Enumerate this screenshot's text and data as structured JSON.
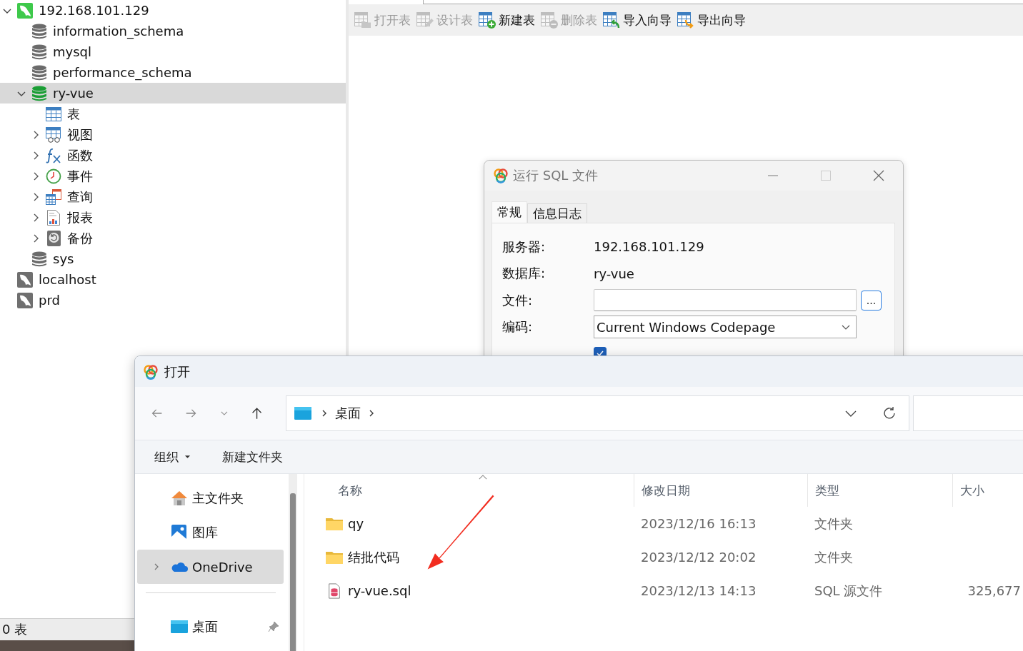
{
  "main": {
    "tree": [
      {
        "kind": "connection",
        "label": "192.168.101.129",
        "connected": true,
        "selected": false,
        "expanded": true,
        "children": [
          {
            "kind": "database",
            "label": "information_schema",
            "open": false,
            "selected": false
          },
          {
            "kind": "database",
            "label": "mysql",
            "open": false,
            "selected": false
          },
          {
            "kind": "database",
            "label": "performance_schema",
            "open": false,
            "selected": false
          },
          {
            "kind": "database",
            "label": "ry-vue",
            "open": true,
            "selected": true,
            "expanded": true,
            "children": [
              {
                "kind": "tables",
                "label": "表",
                "selected": false
              },
              {
                "kind": "views",
                "label": "视图",
                "selected": false,
                "expanded": false
              },
              {
                "kind": "functions",
                "label": "函数",
                "selected": false,
                "expanded": false
              },
              {
                "kind": "events",
                "label": "事件",
                "selected": false,
                "expanded": false
              },
              {
                "kind": "queries",
                "label": "查询",
                "selected": false,
                "expanded": false
              },
              {
                "kind": "reports",
                "label": "报表",
                "selected": false,
                "expanded": false
              },
              {
                "kind": "backups",
                "label": "备份",
                "selected": false,
                "expanded": false
              }
            ]
          },
          {
            "kind": "database",
            "label": "sys",
            "open": false,
            "selected": false
          }
        ]
      },
      {
        "kind": "connection",
        "label": "localhost",
        "connected": false,
        "selected": false
      },
      {
        "kind": "connection",
        "label": "prd",
        "connected": false,
        "selected": false
      }
    ],
    "toolbar": [
      {
        "label": "打开表",
        "disabled": true
      },
      {
        "label": "设计表",
        "disabled": true
      },
      {
        "label": "新建表",
        "disabled": false
      },
      {
        "label": "删除表",
        "disabled": true
      },
      {
        "label": "导入向导",
        "disabled": false
      },
      {
        "label": "导出向导",
        "disabled": false
      }
    ],
    "status_bar": "0 表"
  },
  "run_sql_dialog": {
    "title": "运行 SQL 文件",
    "tabs": [
      {
        "label": "常规",
        "selected": true
      },
      {
        "label": "信息日志",
        "selected": false
      }
    ],
    "fields": [
      {
        "kind": "text",
        "label": "服务器:",
        "value": "192.168.101.129"
      },
      {
        "kind": "text",
        "label": "数据库:",
        "value": "ry-vue"
      },
      {
        "kind": "input",
        "label": "文件:",
        "browse": "..."
      },
      {
        "kind": "select",
        "label": "编码:",
        "value": "Current Windows Codepage"
      }
    ],
    "checkbox": {
      "checked": true
    }
  },
  "open_dialog": {
    "title": "打开",
    "breadcrumb": [
      "桌面"
    ],
    "organize": "组织",
    "new_folder": "新建文件夹",
    "sidebar_groups": [
      {
        "items": [
          {
            "kind": "home",
            "label": "主文件夹",
            "selected": false,
            "expandable": false,
            "pinned": false
          },
          {
            "kind": "gallery",
            "label": "图库",
            "selected": false,
            "expandable": false,
            "pinned": false
          },
          {
            "kind": "cloud",
            "label": "OneDrive",
            "selected": true,
            "expandable": true,
            "pinned": false
          }
        ]
      },
      {
        "items": [
          {
            "kind": "desktop",
            "label": "桌面",
            "selected": false,
            "expandable": false,
            "pinned": true
          }
        ]
      }
    ],
    "columns": [
      "名称",
      "修改日期",
      "类型",
      "大小"
    ],
    "rows": [
      {
        "kind": "folder",
        "name": "qy",
        "modified": "2023/12/16 16:13",
        "type": "文件夹"
      },
      {
        "kind": "folder",
        "name": "结批代码",
        "modified": "2023/12/12 20:02",
        "type": "文件夹"
      },
      {
        "kind": "sql",
        "name": "ry-vue.sql",
        "modified": "2023/12/13 14:13",
        "type": "SQL 源文件",
        "size": "325,677"
      }
    ]
  }
}
